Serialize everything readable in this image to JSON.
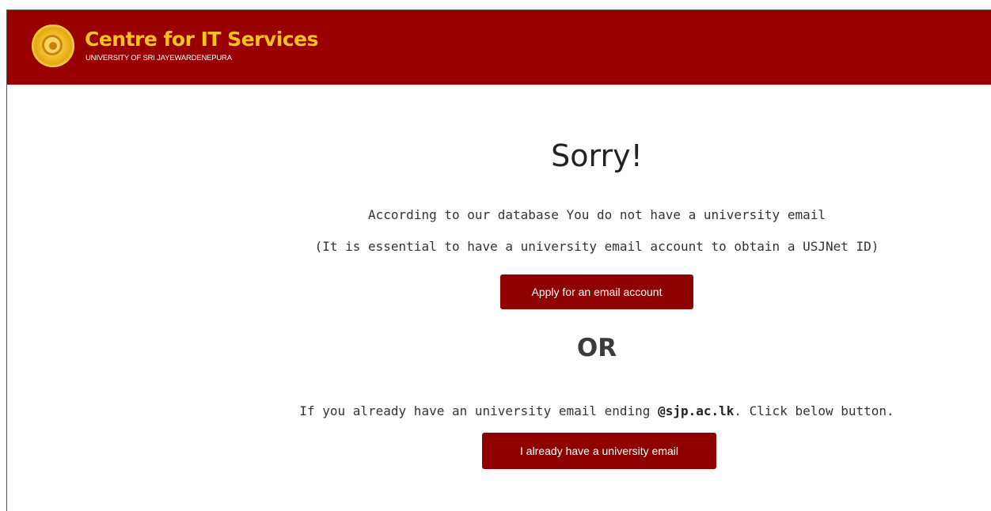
{
  "header": {
    "title": "Centre for IT Services",
    "subtitle": "UNIVERSITY OF SRI JAYEWARDENEPURA",
    "background_color": "#980000",
    "title_color": "#f6c21b",
    "logo_icon": "university-emblem-icon"
  },
  "main": {
    "heading": "Sorry!",
    "message": "According to our database You do not have a university email",
    "note": "(It is essential to have a university email account to obtain a USJNet ID)",
    "apply_button_label": "Apply for an email account",
    "or_text": "OR",
    "existing_prefix": "If you already have an university email ending ",
    "existing_domain": "@sjp.ac.lk",
    "existing_suffix": ". Click below button.",
    "have_email_button_label": "I already have a university email",
    "button_color": "#8f0000"
  }
}
